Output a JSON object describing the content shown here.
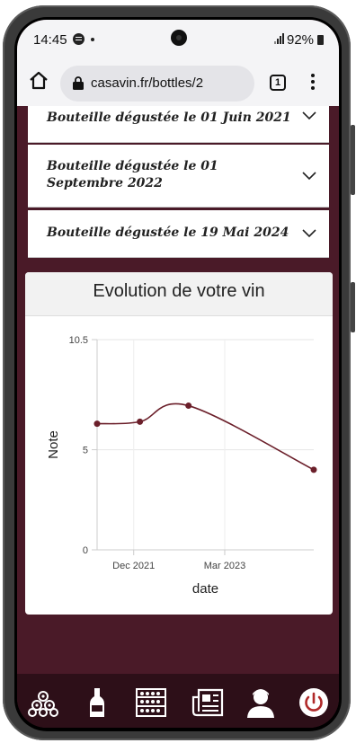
{
  "status_bar": {
    "time": "14:45",
    "battery_percent": "92%",
    "icons": [
      "spotify-icon",
      "notification-dot-icon",
      "signal-icon",
      "battery-icon"
    ]
  },
  "browser": {
    "url": "casavin.fr/bottles/2",
    "tab_count": "1",
    "icons": [
      "home-icon",
      "lock-icon",
      "tabs-icon",
      "overflow-menu-icon"
    ]
  },
  "tastings": [
    {
      "label": "Bouteille dégustée le 01 Juin 2021"
    },
    {
      "label": "Bouteille dégustée le 01 Septembre 2022"
    },
    {
      "label": "Bouteille dégustée le 19 Mai 2024"
    }
  ],
  "chart_card": {
    "title": "Evolution de votre vin"
  },
  "chart_data": {
    "type": "line",
    "title": "Evolution de votre vin",
    "xlabel": "date",
    "ylabel": "Note",
    "x_ticks": [
      "Dec 2021",
      "Mar 2023"
    ],
    "y_ticks": [
      "0",
      "5",
      "10.5"
    ],
    "ylim": [
      0,
      10.5
    ],
    "x_domain": [
      "2021-06-01",
      "2024-05-19"
    ],
    "grid": true,
    "series": [
      {
        "x": [
          "2021-06-01",
          "2022-01-01",
          "2022-09-01",
          "2024-05-19"
        ],
        "y": [
          6.3,
          6.4,
          7.2,
          4.0
        ],
        "color": "#6b1f2a"
      }
    ]
  },
  "bottom_nav": {
    "items": [
      {
        "name": "cellar-barrels-icon"
      },
      {
        "name": "bottle-icon"
      },
      {
        "name": "wine-rack-icon"
      },
      {
        "name": "news-icon"
      },
      {
        "name": "user-icon"
      },
      {
        "name": "power-icon"
      }
    ]
  },
  "colors": {
    "background": "#4a1a28",
    "navbar": "#2d0f18",
    "line": "#6b1f2a",
    "power_accent": "#b02a2a"
  }
}
